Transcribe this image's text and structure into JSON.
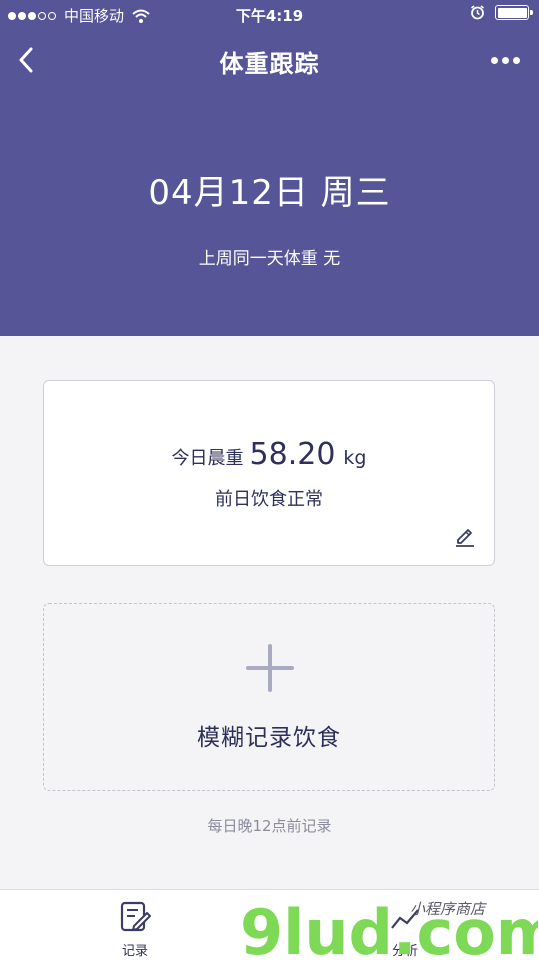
{
  "status_bar": {
    "carrier": "中国移动",
    "time": "下午4:19",
    "icons": [
      "signal-dots-icon",
      "wifi-icon",
      "alarm-icon",
      "battery-icon"
    ]
  },
  "navbar": {
    "title": "体重跟踪",
    "back_icon": "chevron-left-icon",
    "more_icon": "more-dots-icon"
  },
  "header": {
    "date": "04月12日 周三",
    "last_week_note": "上周同一天体重 无"
  },
  "weight_card": {
    "label": "今日晨重",
    "value": "58.20",
    "unit": "kg",
    "diet_status": "前日饮食正常",
    "edit_icon": "pencil-icon"
  },
  "add_diet": {
    "icon": "plus-icon",
    "label": "模糊记录饮食"
  },
  "deadline_note": "每日晚12点前记录",
  "tabbar": {
    "tabs": [
      {
        "label": "记录",
        "icon": "edit-note-icon"
      },
      {
        "label": "分析",
        "icon": "chart-icon"
      }
    ]
  },
  "watermark": {
    "text": "9lud.com",
    "tagline": "小程序商店"
  },
  "colors": {
    "header_bg": "#555597",
    "page_bg": "#f4f4f6",
    "text_primary": "#2f2f5c",
    "text_secondary": "#8c8c9c",
    "watermark_green": "#7ed957",
    "watermark_orange": "#f5a623"
  }
}
